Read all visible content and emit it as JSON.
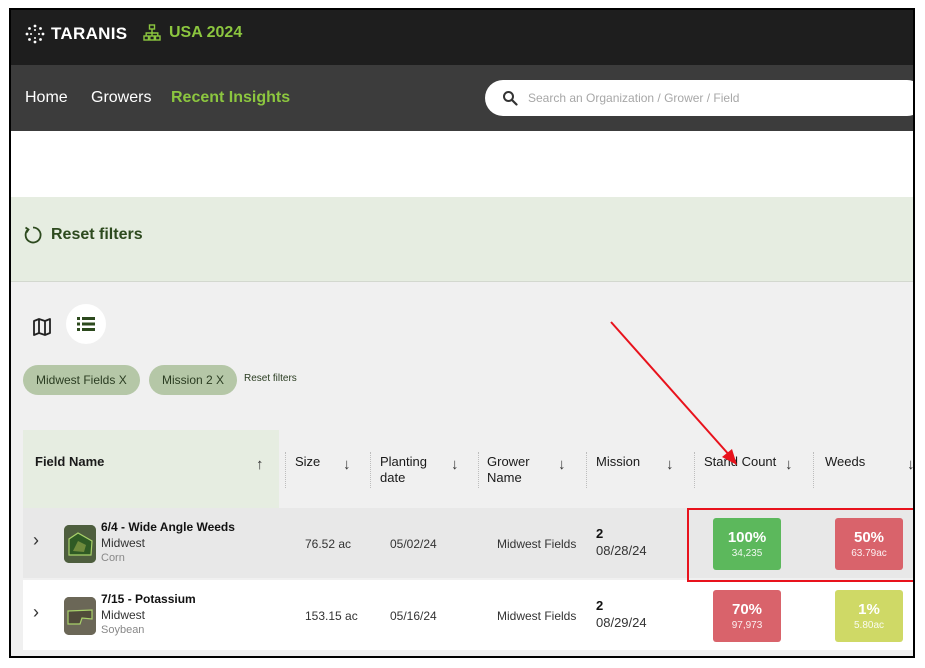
{
  "topbar": {
    "brand": "TARANIS",
    "season": "USA 2024"
  },
  "nav": {
    "items": [
      "Home",
      "Growers",
      "Recent Insights"
    ],
    "active": "Recent Insights",
    "search_placeholder": "Search an Organization / Grower / Field"
  },
  "filters": {
    "reset_label": "Reset filters",
    "chips": [
      {
        "label": "Midwest Fields X"
      },
      {
        "label": "Mission 2 X"
      }
    ],
    "reset_small_label": "Reset filters"
  },
  "table": {
    "headers": {
      "field_name": "Field Name",
      "size": "Size",
      "planting_date_1": "Planting",
      "planting_date_2": "date",
      "grower_1": "Grower",
      "grower_2": "Name",
      "mission": "Mission",
      "stand_count": "Stand Count",
      "weeds": "Weeds"
    },
    "rows": [
      {
        "name": "6/4 - Wide Angle Weeds",
        "region": "Midwest",
        "crop": "Corn",
        "size": "76.52 ac",
        "planting_date": "05/02/24",
        "grower": "Midwest Fields",
        "mission_num": "2",
        "mission_date": "08/28/24",
        "stand_pct": "100%",
        "stand_sub": "34,235",
        "stand_color": "#5cb85c",
        "weeds_pct": "50%",
        "weeds_sub": "63.79ac",
        "weeds_color": "#d9636b"
      },
      {
        "name": "7/15 - Potassium",
        "region": "Midwest",
        "crop": "Soybean",
        "size": "153.15 ac",
        "planting_date": "05/16/24",
        "grower": "Midwest Fields",
        "mission_num": "2",
        "mission_date": "08/29/24",
        "stand_pct": "70%",
        "stand_sub": "97,973",
        "stand_color": "#d9636b",
        "weeds_pct": "1%",
        "weeds_sub": "5.80ac",
        "weeds_color": "#cfd966"
      }
    ]
  },
  "colors": {
    "brand_green": "#8cc63f",
    "annotation_red": "#e8121c"
  }
}
